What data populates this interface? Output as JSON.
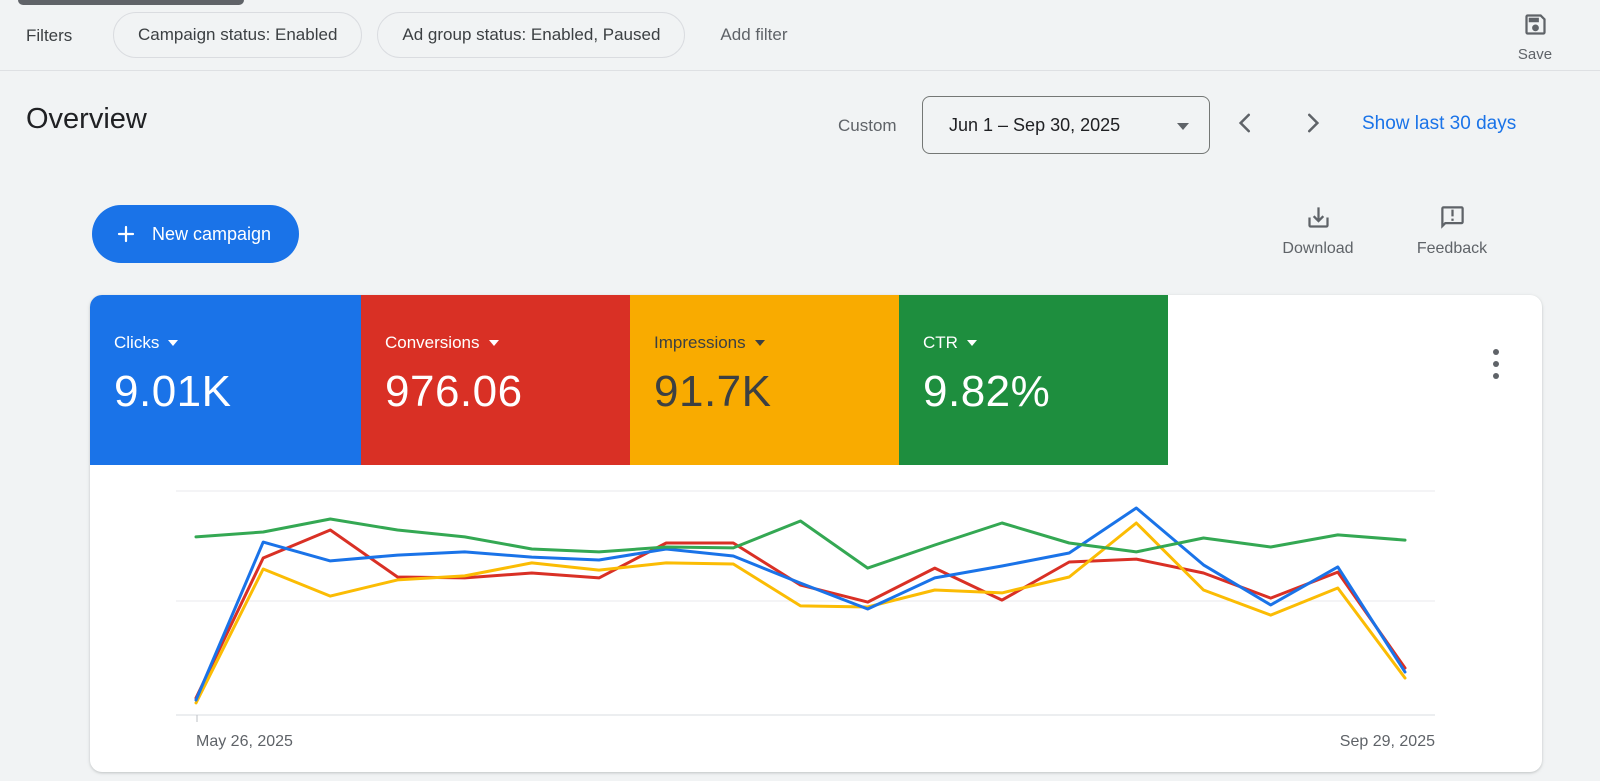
{
  "colors": {
    "accent_blue": "#1A73E8",
    "page_bg": "#F1F3F4",
    "text_primary": "#202124",
    "text_secondary": "#5F6368"
  },
  "filter_bar": {
    "label": "Filters",
    "chips": [
      "Campaign status: Enabled",
      "Ad group status: Enabled, Paused"
    ],
    "add_filter": "Add filter",
    "save": "Save"
  },
  "header": {
    "title": "Overview",
    "date_mode": "Custom",
    "date_range": "Jun 1 – Sep 30, 2025",
    "show_last": "Show last 30 days"
  },
  "actions": {
    "new_campaign": "New campaign",
    "download": "Download",
    "feedback": "Feedback"
  },
  "icons": {
    "save": "floppy-disk",
    "download": "download-arrow-tray",
    "feedback": "speech-bubble-exclamation",
    "new_campaign": "plus",
    "date_nav": "chevron-left / chevron-right",
    "card_menu": "vertical-three-dots",
    "metric_dropdown": "caret-down"
  },
  "metric_cards": [
    {
      "label": "Clicks",
      "value": "9.01K",
      "bg": "#1A73E8",
      "fg": "#FFFFFF"
    },
    {
      "label": "Conversions",
      "value": "976.06",
      "bg": "#D93025",
      "fg": "#FFFFFF"
    },
    {
      "label": "Impressions",
      "value": "91.7K",
      "bg": "#F9AB00",
      "fg": "#3C4043"
    },
    {
      "label": "CTR",
      "value": "9.82%",
      "bg": "#1E8E3E",
      "fg": "#FFFFFF"
    }
  ],
  "chart_data": {
    "type": "line",
    "title": "",
    "x_start_label": "May 26, 2025",
    "x_end_label": "Sep 29, 2025",
    "points": 19,
    "granularity": "weekly",
    "grid": "two horizontal gridlines above baseline, no y-axis tick labels",
    "legend_position": "none (series colors match metric cards)",
    "note": "values are normalized 0-1 as fraction of plot height above the x-axis baseline; chart shows no numeric y-axis",
    "series": [
      {
        "name": "Clicks",
        "color": "#1A73E8",
        "values": [
          0.067,
          0.772,
          0.688,
          0.714,
          0.728,
          0.705,
          0.692,
          0.741,
          0.71,
          0.589,
          0.473,
          0.612,
          0.665,
          0.723,
          0.924,
          0.67,
          0.491,
          0.661,
          0.192
        ]
      },
      {
        "name": "Conversions",
        "color": "#D93025",
        "values": [
          0.076,
          0.701,
          0.826,
          0.616,
          0.612,
          0.634,
          0.612,
          0.768,
          0.768,
          0.58,
          0.504,
          0.656,
          0.513,
          0.683,
          0.696,
          0.634,
          0.522,
          0.638,
          0.21
        ]
      },
      {
        "name": "Impressions",
        "color": "#FBBC04",
        "values": [
          0.054,
          0.652,
          0.531,
          0.603,
          0.621,
          0.679,
          0.647,
          0.679,
          0.674,
          0.487,
          0.482,
          0.558,
          0.545,
          0.616,
          0.857,
          0.558,
          0.446,
          0.567,
          0.165
        ]
      },
      {
        "name": "CTR",
        "color": "#34A853",
        "values": [
          0.795,
          0.817,
          0.875,
          0.826,
          0.795,
          0.741,
          0.728,
          0.75,
          0.746,
          0.866,
          0.656,
          0.759,
          0.857,
          0.768,
          0.728,
          0.79,
          0.75,
          0.804,
          0.781
        ]
      }
    ]
  }
}
